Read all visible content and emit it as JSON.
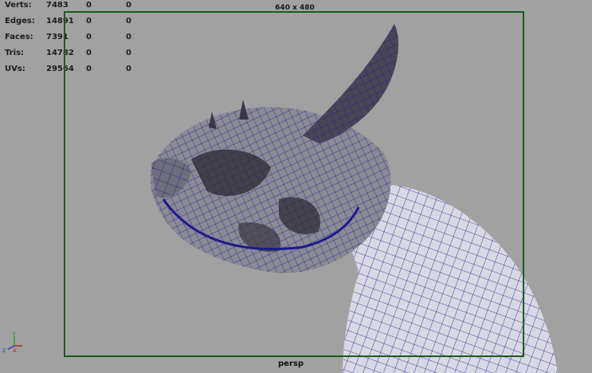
{
  "hud": {
    "rows": [
      {
        "label": "Verts:",
        "v1": "7483",
        "v2": "0",
        "v3": "0"
      },
      {
        "label": "Edges:",
        "v1": "14891",
        "v2": "0",
        "v3": "0"
      },
      {
        "label": "Faces:",
        "v1": "7391",
        "v2": "0",
        "v3": "0"
      },
      {
        "label": "Tris:",
        "v1": "14782",
        "v2": "0",
        "v3": "0"
      },
      {
        "label": "UVs:",
        "v1": "29564",
        "v2": "0",
        "v3": "0"
      }
    ]
  },
  "viewport": {
    "resolution": "640 x 480",
    "camera": "persp",
    "axis": {
      "y": "Y",
      "z": "z",
      "x": "x"
    }
  },
  "colors": {
    "background": "#a1a1a1",
    "gate": "#1c5b1c",
    "wire": "#1a1a8c"
  },
  "icons": {
    "axis": "axis-gizmo-icon",
    "mesh": "creature-mesh"
  }
}
